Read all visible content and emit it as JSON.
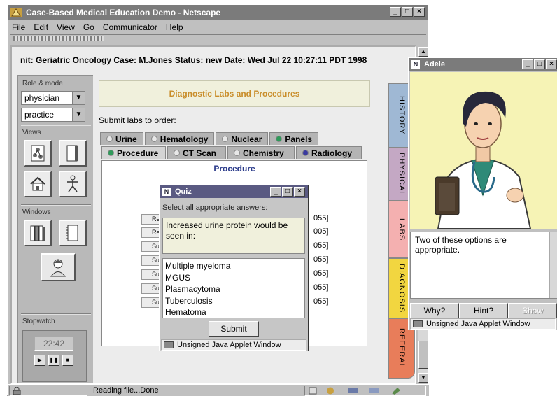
{
  "browser": {
    "title": "Case-Based Medical Education Demo - Netscape",
    "menu": [
      "File",
      "Edit",
      "View",
      "Go",
      "Communicator",
      "Help"
    ],
    "status_text": "Reading file...Done"
  },
  "case_header": "nit: Geriatric Oncology  Case: M.Jones  Status: new  Date: Wed Jul 22 10:27:11 PDT 1998",
  "left_panel": {
    "role_mode_label": "Role & mode",
    "role_value": "physician",
    "mode_value": "practice",
    "views_label": "Views",
    "windows_label": "Windows",
    "stopwatch_label": "Stopwatch",
    "stopwatch_time": "22:42"
  },
  "main": {
    "header": "Diagnostic Labs and Procedures",
    "submit_labs": "Submit labs to order:",
    "tabs_row1": [
      "Urine",
      "Hematology",
      "Nuclear",
      "Panels"
    ],
    "tabs_row2": [
      "Procedure",
      "CT Scan",
      "Chemistry",
      "Radiology"
    ],
    "panel_title": "Procedure",
    "proc_buttons": [
      "Re",
      "Re",
      "Su",
      "Su",
      "Su",
      "Su",
      "Su"
    ],
    "proc_codes": [
      "055]",
      "005]",
      "055]",
      "055]",
      "055]",
      "055]",
      "055]"
    ]
  },
  "side_tabs": [
    "HISTORY",
    "PHYSICAL",
    "LABS",
    "DIAGNOSIS",
    "REFERAL"
  ],
  "quiz": {
    "title": "Quiz",
    "instruction": "Select all appropriate answers:",
    "question": "Increased urine protein would be seen in:",
    "options": [
      "Multiple myeloma",
      "MGUS",
      "Plasmacytoma",
      "Tuberculosis",
      "Hematoma"
    ],
    "submit": "Submit",
    "warning": "Unsigned Java Applet Window"
  },
  "adele": {
    "title": "Adele",
    "message": "Two of these options are appropriate.",
    "buttons": [
      "Why?",
      "Hint?",
      "Show"
    ],
    "warning": "Unsigned Java Applet Window"
  },
  "colors": {
    "tab_green": "#2f9a5a",
    "tab_blue": "#3a3aa0",
    "side_history": "#9fb8d4",
    "side_physical": "#c4a8c4",
    "side_labs": "#f4b0b0",
    "side_diagnosis": "#f2d640",
    "side_referal": "#e87d5a"
  }
}
